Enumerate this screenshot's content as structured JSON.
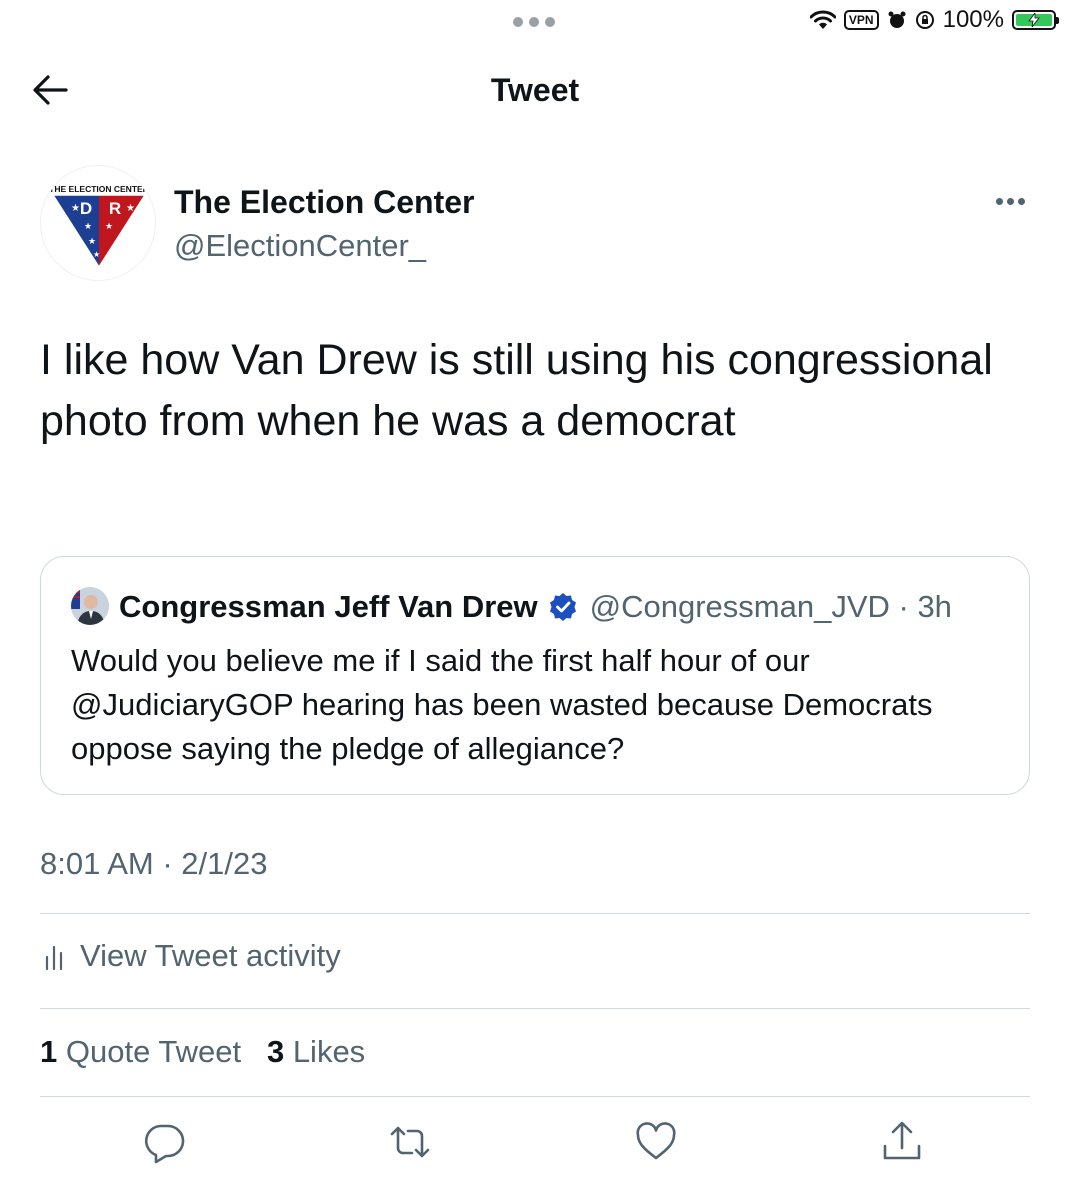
{
  "status_bar": {
    "vpn_label": "VPN",
    "battery_text": "100%",
    "icons": [
      "wifi-icon",
      "vpn-icon",
      "alarm-icon",
      "orientation-lock-icon",
      "battery-charging-icon"
    ],
    "battery_level": 1.0,
    "battery_color": "#34c759"
  },
  "header": {
    "title": "Tweet",
    "back_icon": "arrow-left-icon"
  },
  "tweet": {
    "author": {
      "name": "The Election Center",
      "handle": "@ElectionCenter_",
      "avatar_logo_text": "THE ELECTION CENTER",
      "avatar_letters": [
        "D",
        "R"
      ]
    },
    "text": "I like how Van Drew is still using his congressional photo from when he was a democrat",
    "quote": {
      "name": "Congressman Jeff Van Drew",
      "handle_time": "@Congressman_JVD · 3h",
      "text": "Would you believe me if I said the first half hour of our @JudiciaryGOP hearing has been wasted because Democrats oppose saying the pledge of allegiance?"
    },
    "timestamp": "8:01 AM · 2/1/23",
    "activity_label": "View Tweet activity",
    "stats": {
      "quote_count": "1",
      "quote_label": "Quote Tweet",
      "like_count": "3",
      "like_label": "Likes"
    },
    "actions": [
      "reply-icon",
      "retweet-icon",
      "like-icon",
      "share-icon"
    ]
  },
  "colors": {
    "text": "#0f1419",
    "secondary": "#536471",
    "border": "#cfd9de",
    "verified": "#1d4fbf",
    "logo_red": "#c0161d",
    "logo_blue": "#1c3f94"
  }
}
